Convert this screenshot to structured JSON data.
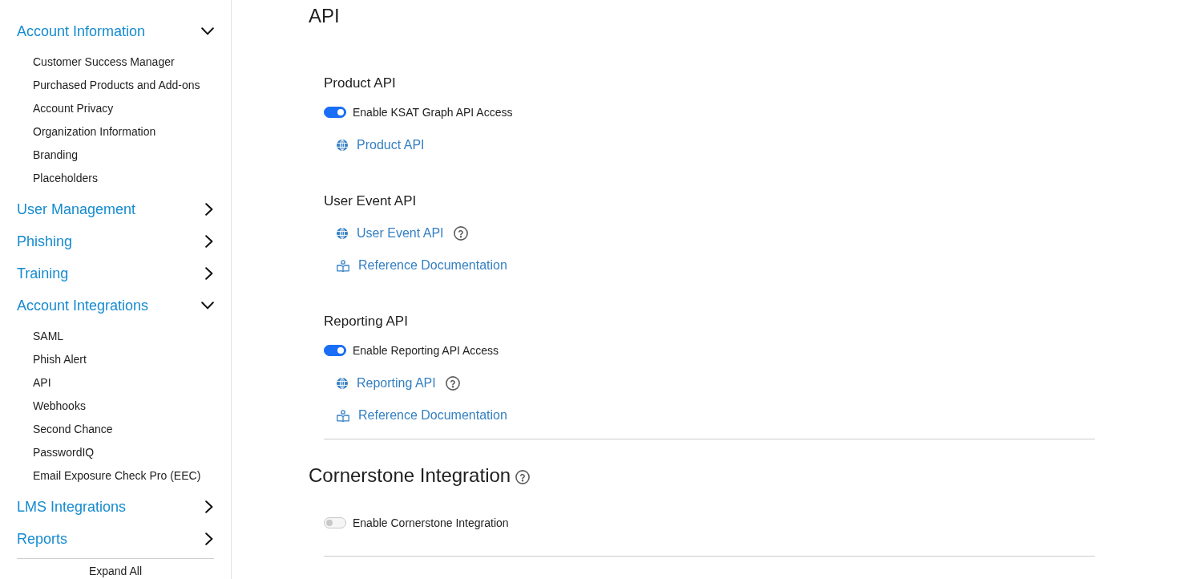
{
  "sidebar": {
    "groups": [
      {
        "label": "Account Information",
        "expanded": true,
        "items": [
          {
            "label": "Customer Success Manager"
          },
          {
            "label": "Purchased Products and Add-ons"
          },
          {
            "label": "Account Privacy"
          },
          {
            "label": "Organization Information"
          },
          {
            "label": "Branding"
          },
          {
            "label": "Placeholders"
          }
        ]
      },
      {
        "label": "User Management",
        "expanded": false
      },
      {
        "label": "Phishing",
        "expanded": false
      },
      {
        "label": "Training",
        "expanded": false
      },
      {
        "label": "Account Integrations",
        "expanded": true,
        "items": [
          {
            "label": "SAML"
          },
          {
            "label": "Phish Alert"
          },
          {
            "label": "API"
          },
          {
            "label": "Webhooks"
          },
          {
            "label": "Second Chance"
          },
          {
            "label": "PasswordIQ"
          },
          {
            "label": "Email Exposure Check Pro (EEC)"
          }
        ]
      },
      {
        "label": "LMS Integrations",
        "expanded": false
      },
      {
        "label": "Reports",
        "expanded": false
      }
    ],
    "expand_all": "Expand All"
  },
  "main": {
    "title": "API",
    "sections": [
      {
        "heading": "Product API",
        "toggle": {
          "label": "Enable KSAT Graph API Access",
          "on": true
        },
        "links": [
          {
            "label": "Product API",
            "kind": "api"
          }
        ]
      },
      {
        "heading": "User Event API",
        "links": [
          {
            "label": "User Event API",
            "kind": "api",
            "help": true
          },
          {
            "label": "Reference Documentation",
            "kind": "docs"
          }
        ]
      },
      {
        "heading": "Reporting API",
        "toggle": {
          "label": "Enable Reporting API Access",
          "on": true
        },
        "links": [
          {
            "label": "Reporting API",
            "kind": "api",
            "help": true
          },
          {
            "label": "Reference Documentation",
            "kind": "docs"
          }
        ]
      }
    ],
    "integrations": [
      {
        "title": "Cornerstone Integration",
        "help": true,
        "toggle": {
          "label": "Enable Cornerstone Integration",
          "on": false
        }
      }
    ]
  }
}
